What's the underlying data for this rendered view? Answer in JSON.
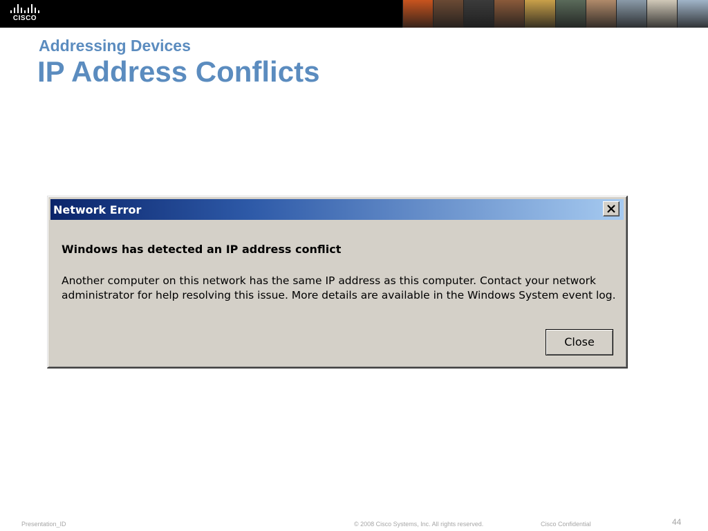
{
  "brand": {
    "logo_text": "CISCO",
    "photo_colors": [
      "#c8541e",
      "#6a4a34",
      "#3b3b3b",
      "#8a5a3a",
      "#c9a04a",
      "#5a6a5a",
      "#b08a6a",
      "#8a9aa8",
      "#d0c8b8",
      "#a0b4c8"
    ]
  },
  "slide": {
    "subtitle": "Addressing Devices",
    "title": "IP Address Conflicts"
  },
  "dialog": {
    "title": "Network Error",
    "heading": "Windows has detected an IP address conflict",
    "body_line1": "Another computer on this network has the same IP address as this computer. Contact your network",
    "body_line2": "administrator for help resolving this issue. More details are available in the Windows System event log.",
    "close_button_label": "Close",
    "close_icon": "close-x-icon"
  },
  "footer": {
    "presentation_id": "Presentation_ID",
    "copyright": "© 2008 Cisco Systems, Inc. All rights reserved.",
    "confidential": "Cisco Confidential",
    "page_number": "44"
  },
  "colors": {
    "title_blue": "#5b8cbf",
    "dialog_face": "#d4d0c8",
    "titlebar_start": "#0a246a",
    "titlebar_end": "#a6caf0"
  }
}
